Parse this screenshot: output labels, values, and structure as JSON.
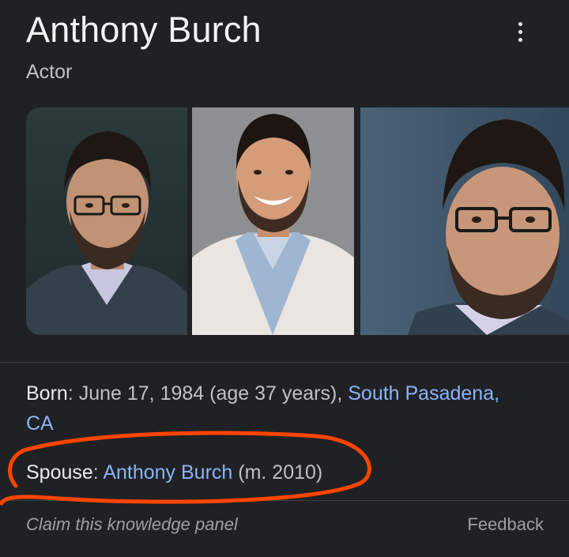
{
  "header": {
    "title": "Anthony Burch",
    "subtitle": "Actor"
  },
  "photos": [
    {
      "alt": "Anthony Burch photo 1"
    },
    {
      "alt": "Anthony Burch photo 2"
    },
    {
      "alt": "Anthony Burch photo 3"
    }
  ],
  "facts": {
    "born": {
      "label": "Born",
      "separator": ": ",
      "text": "June 17, 1984 (age 37 years), ",
      "link_line1": "South Pasadena,",
      "link_line2": "CA"
    },
    "spouse": {
      "label": "Spouse",
      "separator": ": ",
      "link": "Anthony Burch",
      "suffix": " (m. 2010)"
    }
  },
  "footer": {
    "claim": "Claim this knowledge panel",
    "feedback": "Feedback"
  },
  "colors": {
    "background": "#202124",
    "link": "#8ab4f8",
    "annotation": "#ff4500"
  },
  "icons": {
    "more": "more-vert-icon"
  }
}
